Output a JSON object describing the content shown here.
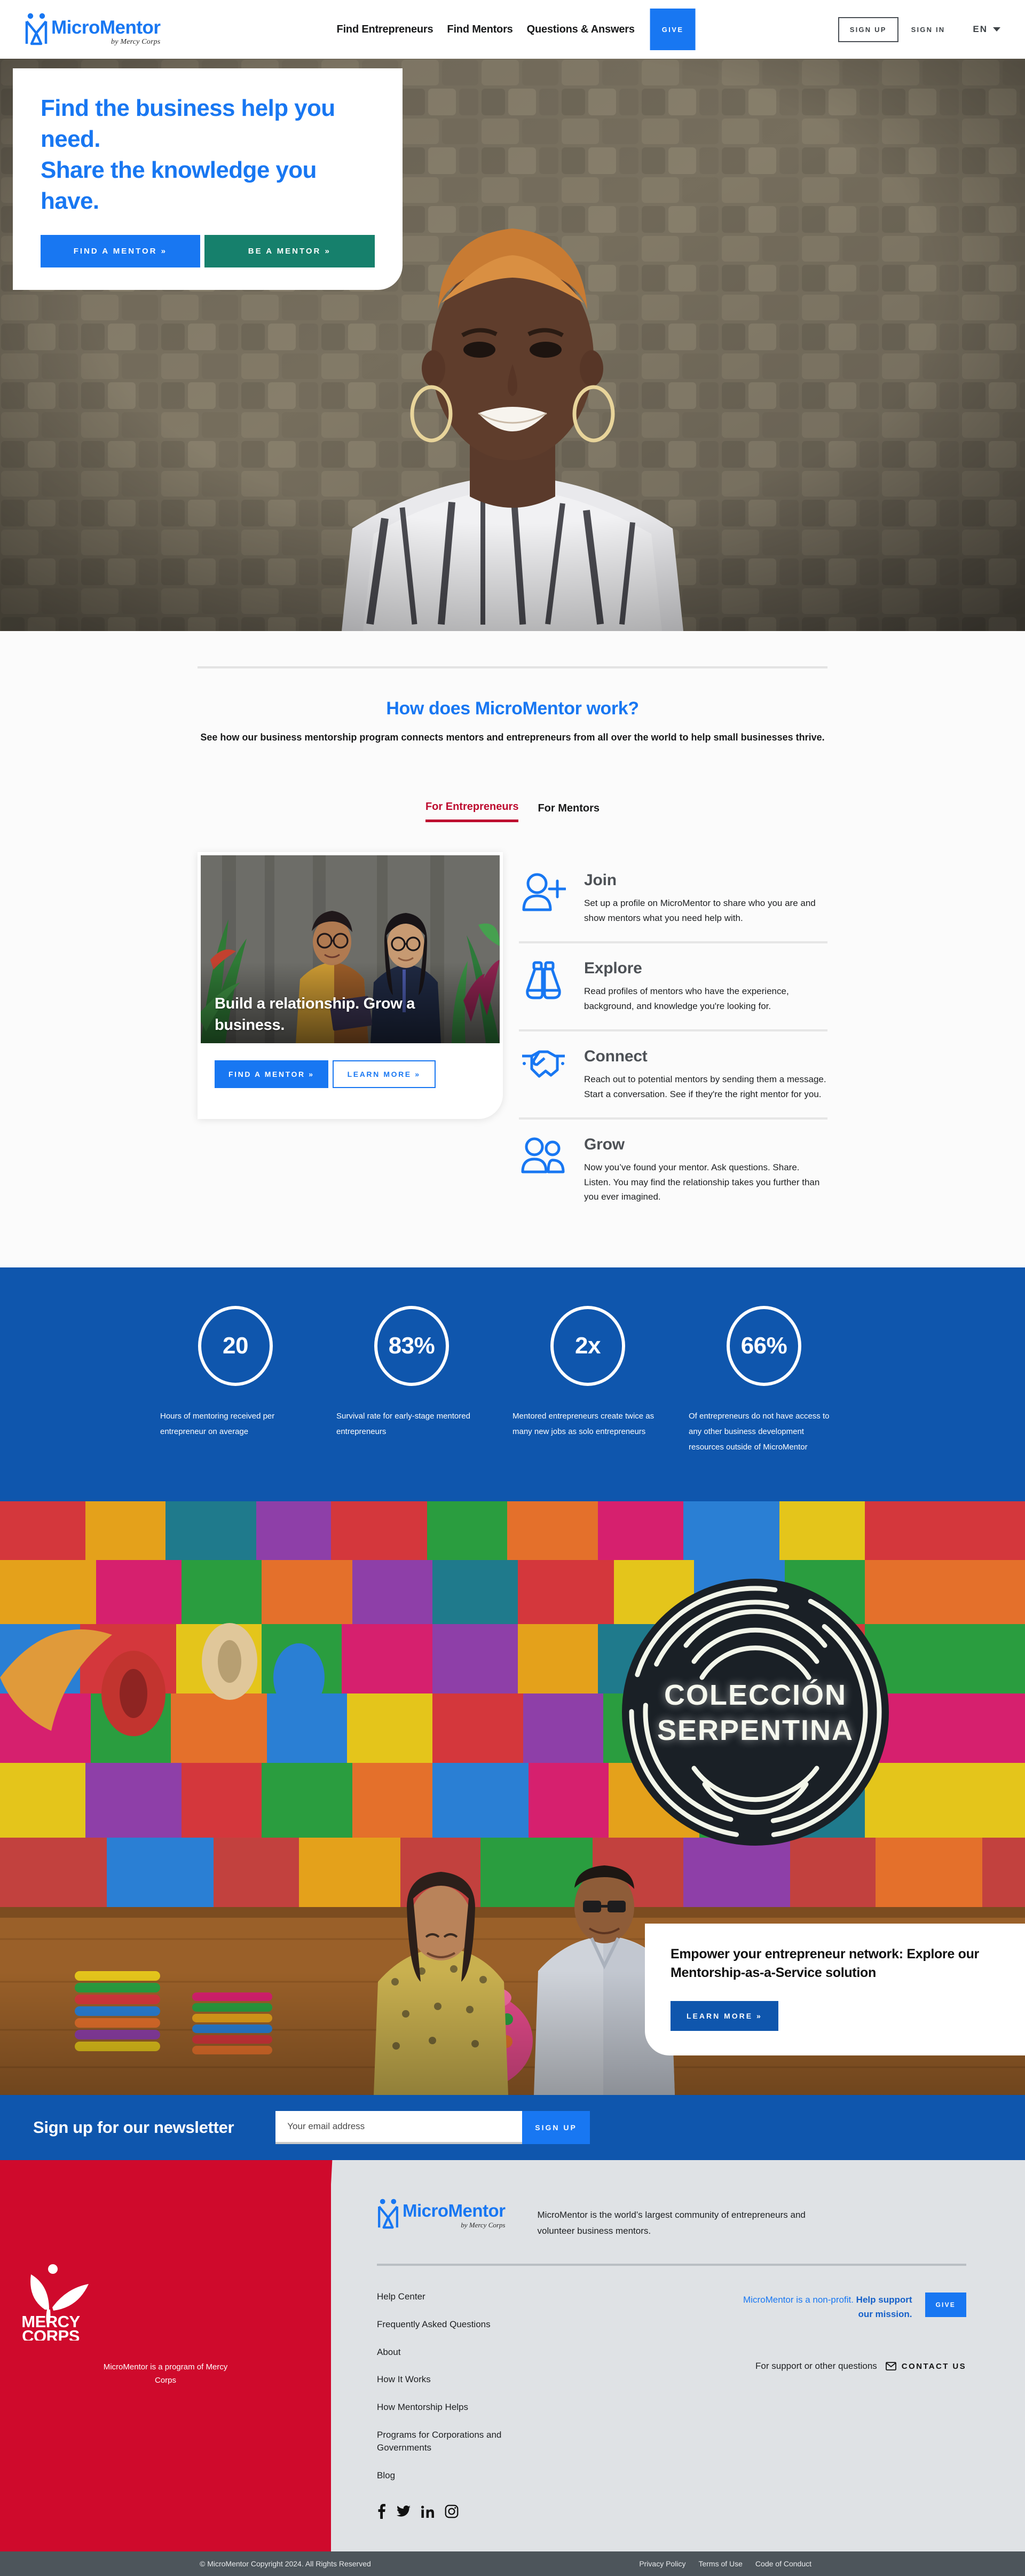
{
  "header": {
    "logo_name": "MicroMentor",
    "logo_sub": "by Mercy Corps",
    "nav": [
      {
        "label": "Find Entrepreneurs"
      },
      {
        "label": "Find Mentors"
      },
      {
        "label": "Questions & Answers"
      }
    ],
    "give_label": "GIVE",
    "signup_label": "SIGN UP",
    "signin_label": "SIGN IN",
    "language": "EN"
  },
  "hero": {
    "headline_line1": "Find the business help you need.",
    "headline_line2": "Share the knowledge you have.",
    "find_mentor_label": "FIND A MENTOR »",
    "be_mentor_label": "BE A MENTOR »"
  },
  "how": {
    "title": "How does MicroMentor work?",
    "subtitle": "See how our business mentorship program connects mentors and entrepreneurs from all over the world to help small businesses thrive.",
    "tabs": [
      {
        "label": "For Entrepreneurs",
        "active": true
      },
      {
        "label": "For Mentors",
        "active": false
      }
    ],
    "card": {
      "caption": "Build a relationship. Grow a business.",
      "primary_label": "FIND A MENTOR »",
      "secondary_label": "LEARN MORE »"
    },
    "steps": [
      {
        "icon": "user-plus-icon",
        "title": "Join",
        "text": "Set up a profile on MicroMentor to share who you are and show mentors what you need help with."
      },
      {
        "icon": "binoculars-icon",
        "title": "Explore",
        "text": "Read profiles of mentors who have the experience, background, and knowledge you're looking for."
      },
      {
        "icon": "handshake-icon",
        "title": "Connect",
        "text": "Reach out to potential mentors by sending them a message. Start a conversation. See if they're the right mentor for you."
      },
      {
        "icon": "two-people-icon",
        "title": "Grow",
        "text": "Now you’ve found your mentor. Ask questions. Share. Listen. You may find the relationship takes you further than you ever imagined."
      }
    ]
  },
  "stats": [
    {
      "value": "20",
      "label": "Hours of mentoring received per entrepreneur on average"
    },
    {
      "value": "83%",
      "label": "Survival rate for early-stage mentored entrepreneurs"
    },
    {
      "value": "2x",
      "label": "Mentored entrepreneurs create twice as many new jobs as solo entrepreneurs"
    },
    {
      "value": "66%",
      "label": "Of entrepreneurs do not have access to any other business development resources outside of MicroMentor"
    }
  ],
  "showcase": {
    "sign_line1": "COLECCIÓN",
    "sign_line2": "SERPENTINA",
    "cta_title": "Empower your entrepreneur network: Explore our Mentorship-as-a-Service solution",
    "cta_button": "LEARN MORE »"
  },
  "newsletter": {
    "title": "Sign up for our newsletter",
    "placeholder": "Your email address",
    "button": "SIGN UP"
  },
  "footer": {
    "mercy_corps_line1": "MERCY",
    "mercy_corps_line2": "CORPS",
    "mercy_caption": "MicroMentor is a program of Mercy Corps",
    "logo_name": "MicroMentor",
    "logo_sub": "by Mercy Corps",
    "description": "MicroMentor is the world’s largest community of entrepreneurs and volunteer business mentors.",
    "links": [
      {
        "label": "Help Center"
      },
      {
        "label": "Frequently Asked Questions"
      },
      {
        "label": "About"
      },
      {
        "label": "How It Works"
      },
      {
        "label": "How Mentorship Helps"
      },
      {
        "label": "Programs for Corporations and Governments"
      },
      {
        "label": "Blog"
      }
    ],
    "social": [
      {
        "name": "facebook-icon"
      },
      {
        "name": "twitter-icon"
      },
      {
        "name": "linkedin-icon"
      },
      {
        "name": "instagram-icon"
      }
    ],
    "nonprofit_plain": "MicroMentor is a non-profit. ",
    "nonprofit_bold": "Help support our mission.",
    "give_label": "GIVE",
    "support_label": "For support or other questions",
    "contact_label": "CONTACT US",
    "copyright": "© MicroMentor Copyright 2024. All Rights Reserved",
    "legal_links": [
      {
        "label": "Privacy Policy"
      },
      {
        "label": "Terms of Use"
      },
      {
        "label": "Code of Conduct"
      }
    ]
  }
}
